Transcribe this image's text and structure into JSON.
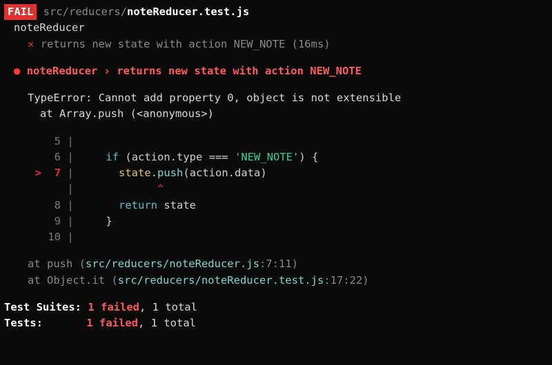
{
  "header": {
    "badge": "FAIL",
    "path_dim": "src/reducers/",
    "path_bright": "noteReducer.test.js"
  },
  "suite": {
    "name": "noteReducer",
    "test_x": "✕",
    "test_name": "returns new state with action NEW_NOTE",
    "test_time": "(16ms)"
  },
  "failure": {
    "bullet": "●",
    "crumb": "noteReducer › returns new state with action NEW_NOTE"
  },
  "error": {
    "line1": "TypeError: Cannot add property 0, object is not extensible",
    "line2": "at Array.push (<anonymous>)"
  },
  "code": {
    "l5_num": "5",
    "l6_num": "6",
    "l6_if": "if",
    "l6_open": " (action.type ",
    "l6_eq": "===",
    "l6_sp": " ",
    "l6_str": "'NEW_NOTE'",
    "l6_close": ") {",
    "ptr": ">",
    "l7_num": "7",
    "l7_state": "state",
    "l7_dot": ".",
    "l7_push": "push",
    "l7_args": "(action.data)",
    "caret": "^",
    "l8_num": "8",
    "l8_return": "return",
    "l8_state": " state",
    "l9_num": "9",
    "l9_brace": "}",
    "l10_num": "10"
  },
  "stack": {
    "s1_prefix": "at push (",
    "s1_path": "src/reducers/noteReducer.js",
    "s1_loc": ":7:11)",
    "s2_prefix": "at Object.it (",
    "s2_path": "src/reducers/noteReducer.test.js",
    "s2_loc": ":17:22)"
  },
  "summary": {
    "suites_label": "Test Suites:",
    "suites_fail": "1 failed",
    "suites_rest": ", 1 total",
    "tests_label": "Tests:",
    "tests_fail": "1 failed",
    "tests_rest": ", 1 total"
  }
}
